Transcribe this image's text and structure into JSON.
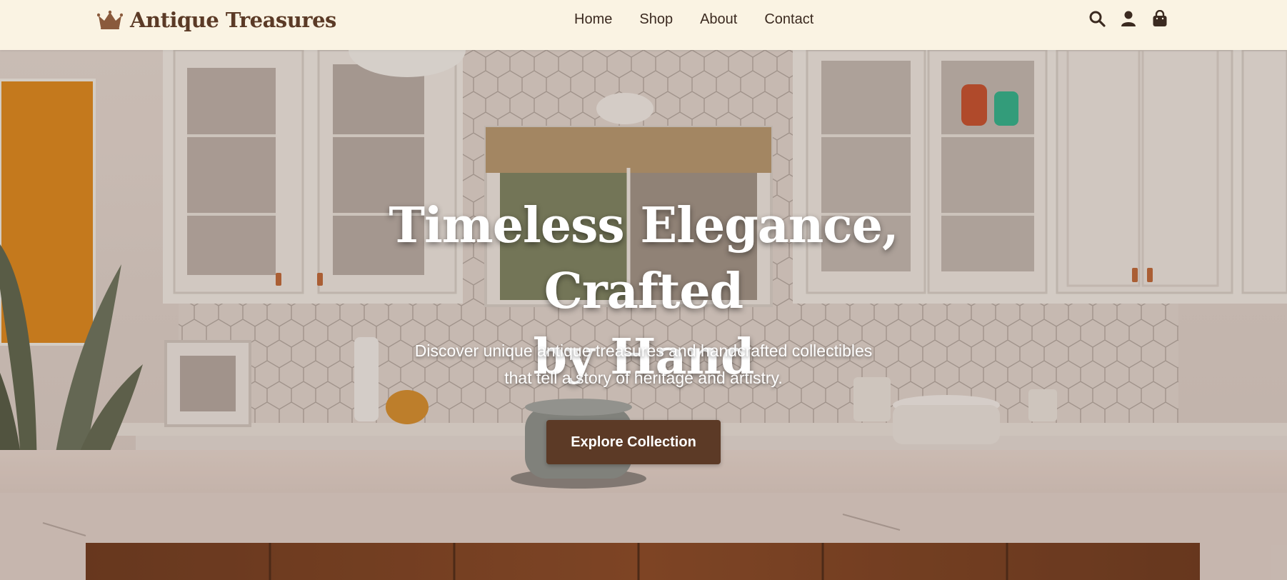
{
  "brand": {
    "name": "Antique Treasures",
    "logo_icon": "crown-icon"
  },
  "nav": {
    "links": [
      {
        "label": "Home"
      },
      {
        "label": "Shop"
      },
      {
        "label": "About"
      },
      {
        "label": "Contact"
      }
    ],
    "icons": [
      "search-icon",
      "user-icon",
      "shopping-bag-icon"
    ]
  },
  "hero": {
    "title_line1": "Timeless Elegance, Crafted",
    "title_line2": "by Hand",
    "subtitle_line1": "Discover unique antique treasures and handcrafted collectibles",
    "subtitle_line2": "that tell a story of heritage and artistry.",
    "cta_label": "Explore Collection"
  },
  "colors": {
    "nav_background": "#faf3e3",
    "brand_text": "#5b3a26",
    "cta_background": "#5c3a26",
    "hero_text": "#ffffff"
  }
}
